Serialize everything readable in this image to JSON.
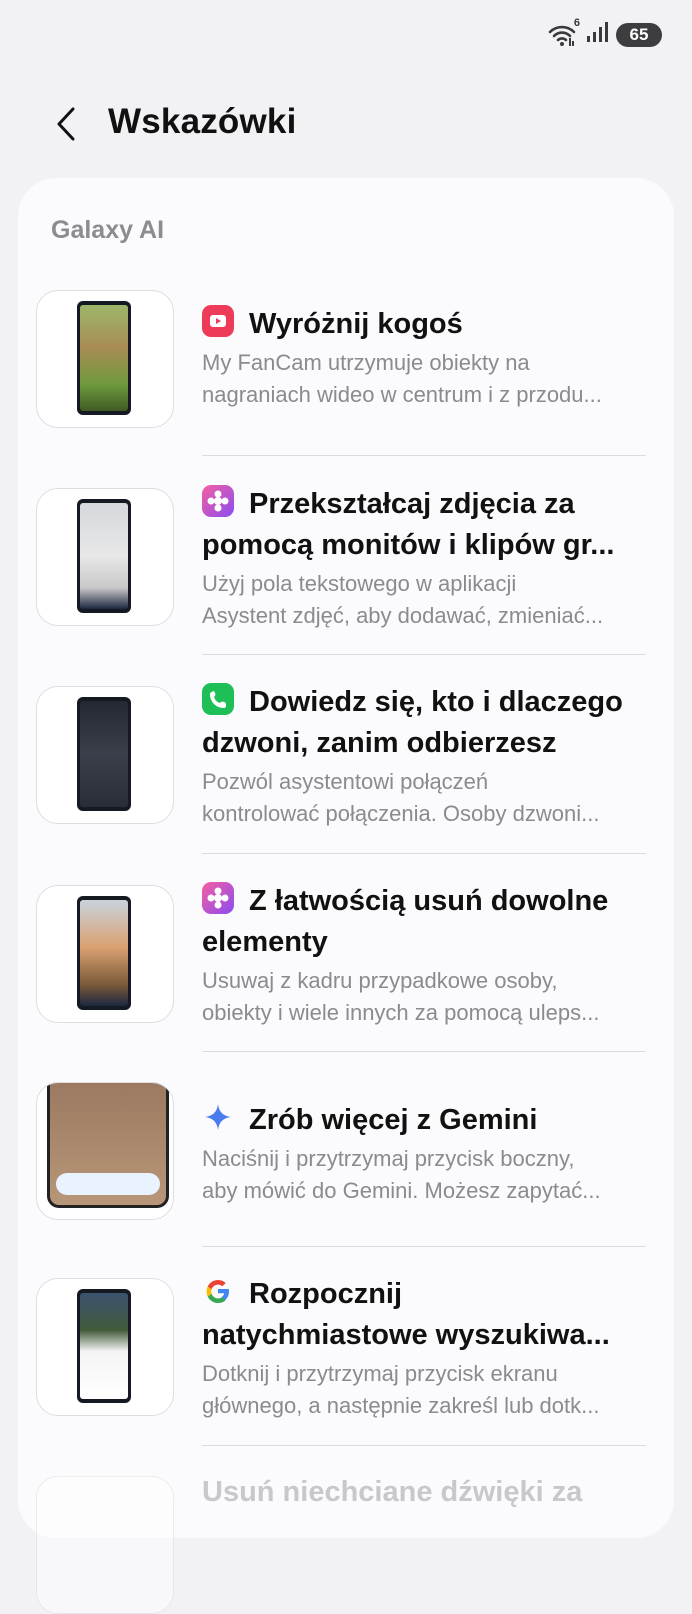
{
  "status": {
    "wifi_label": "6",
    "battery": "65"
  },
  "header": {
    "title": "Wskazówki"
  },
  "section": {
    "title": "Galaxy AI"
  },
  "items": [
    {
      "icon": "video-highlight-icon",
      "icon_color": "#ef3b5a",
      "title_line1": "Wyróżnij kogoś",
      "title_line2": "",
      "desc_line1": "My FanCam utrzymuje obiekty na",
      "desc_line2": "nagraniach wideo w centrum i z przodu..."
    },
    {
      "icon": "photo-flower-icon",
      "icon_color": "#e2438a",
      "title_line1": "Przekształcaj zdjęcia za",
      "title_line2": "pomocą monitów i klipów gr...",
      "desc_line1": "Użyj pola tekstowego w aplikacji",
      "desc_line2": "Asystent zdjęć, aby dodawać, zmieniać..."
    },
    {
      "icon": "phone-call-icon",
      "icon_color": "#1fbf57",
      "title_line1": "Dowiedz się, kto i dlaczego",
      "title_line2": "dzwoni, zanim odbierzesz",
      "desc_line1": "Pozwól asystentowi połączeń",
      "desc_line2": "kontrolować połączenia. Osoby dzwoni..."
    },
    {
      "icon": "photo-flower-icon",
      "icon_color": "#e2438a",
      "title_line1": "Z łatwością usuń dowolne",
      "title_line2": "elementy",
      "desc_line1": "Usuwaj z kadru przypadkowe osoby,",
      "desc_line2": "obiekty i wiele innych za pomocą uleps..."
    },
    {
      "icon": "gemini-sparkle-icon",
      "icon_color": "#4a7cf0",
      "title_line1": "Zrób więcej z Gemini",
      "title_line2": "",
      "desc_line1": "Naciśnij i przytrzymaj przycisk boczny,",
      "desc_line2": "aby mówić do Gemini. Możesz zapytać..."
    },
    {
      "icon": "google-g-icon",
      "icon_color": "#4285f4",
      "title_line1": "Rozpocznij",
      "title_line2": "natychmiastowe wyszukiwa...",
      "desc_line1": "Dotknij i przytrzymaj przycisk ekranu",
      "desc_line2": "głównego, a następnie zakreśl lub dotk..."
    },
    {
      "icon": "",
      "icon_color": "",
      "title_line1": "Usuń niechciane dźwięki za",
      "title_line2": "",
      "desc_line1": "",
      "desc_line2": ""
    }
  ]
}
